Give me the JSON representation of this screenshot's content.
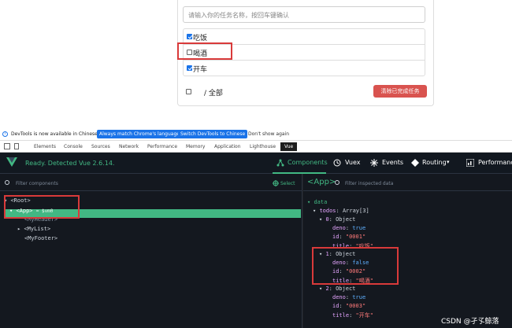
{
  "app": {
    "input_placeholder": "请输入你的任务名称，按回车键确认",
    "todos": [
      {
        "title": "吃饭",
        "done": true
      },
      {
        "title": "喝酒",
        "done": false
      },
      {
        "title": "开车",
        "done": true
      }
    ],
    "footer_label": "/ 全部",
    "clear_button": "清除已完成任务"
  },
  "devtools": {
    "infobar": {
      "message": "DevTools is now available in Chinese!",
      "btn_match": "Always match Chrome's language",
      "btn_switch": "Switch DevTools to Chinese",
      "btn_dismiss": "Don't show again"
    },
    "tabs": [
      "Elements",
      "Console",
      "Sources",
      "Network",
      "Performance",
      "Memory",
      "Application",
      "Lighthouse",
      "Vue"
    ],
    "vue": {
      "status": "Ready. Detected Vue 2.6.14.",
      "nav": {
        "components": "Components",
        "vuex": "Vuex",
        "events": "Events",
        "routing": "Routing",
        "performance": "Performance"
      },
      "filter_components": "Filter components",
      "select": "Select",
      "selected_component": "<App>",
      "filter_data": "Filter inspected data",
      "tree": {
        "root": "<Root>",
        "app": "<App>",
        "app_var": "= $vm0",
        "myheader": "<MyHeader>",
        "mylist": "<MyList>",
        "myfooter": "<MyFooter>"
      },
      "data": {
        "section": "data",
        "todos_key": "todos",
        "todos_type": "Array[3]",
        "items": [
          {
            "index": "0",
            "type": "Object",
            "deno": "true",
            "id": "\"0001\"",
            "title": "\"吃饭\""
          },
          {
            "index": "1",
            "type": "Object",
            "deno": "false",
            "id": "\"0002\"",
            "title": "\"喝酒\""
          },
          {
            "index": "2",
            "type": "Object",
            "deno": "true",
            "id": "\"0003\"",
            "title": "\"开车\""
          }
        ]
      }
    }
  },
  "watermark": "CSDN @孑孓鲸落"
}
